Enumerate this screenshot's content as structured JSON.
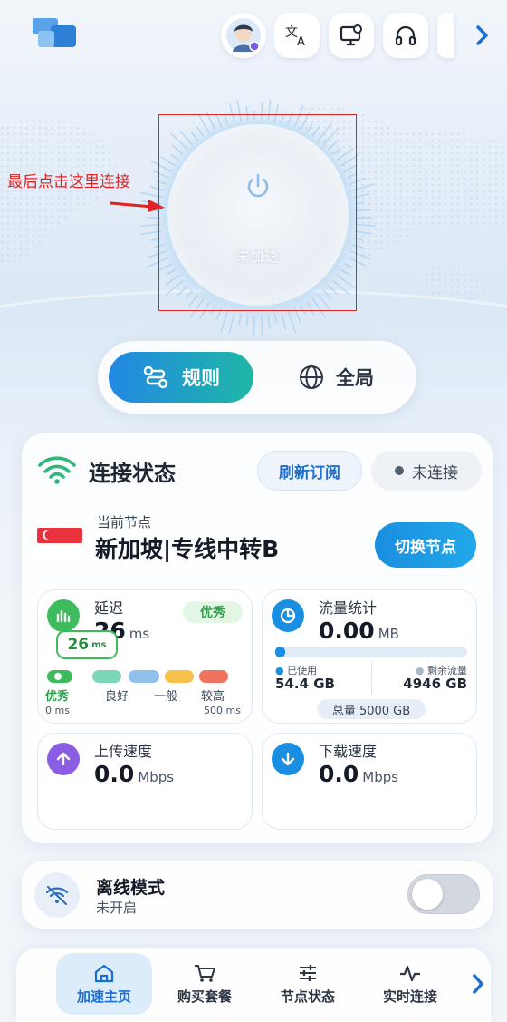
{
  "annotation": {
    "text": "最后点击这里连接"
  },
  "connect_button": {
    "status_text": "未加速"
  },
  "mode": {
    "rule_label": "规则",
    "global_label": "全局"
  },
  "status_card": {
    "title": "连接状态",
    "refresh_label": "刷新订阅",
    "connection_status": "未连接",
    "node_label": "当前节点",
    "node_name": "新加坡|专线中转B",
    "switch_node_label": "切换节点"
  },
  "latency": {
    "title": "延迟",
    "value": "26",
    "unit": "ms",
    "badge": "优秀",
    "bubble_value": "26",
    "bubble_unit": "ms",
    "levels": [
      "优秀",
      "良好",
      "一般",
      "较高"
    ],
    "range_min": "0 ms",
    "range_max": "500 ms",
    "colors": [
      "#3ebc5d",
      "#7dd6b5",
      "#8fc1ec",
      "#f6c14a",
      "#f0735e"
    ]
  },
  "traffic": {
    "title": "流量统计",
    "value": "0.00",
    "unit": "MB",
    "used_label": "已使用",
    "used_value": "54.4 GB",
    "remaining_label": "剩余流量",
    "remaining_value": "4946 GB",
    "total": "总量 5000 GB",
    "used_fraction": 0.011
  },
  "upload": {
    "title": "上传速度",
    "value": "0.0",
    "unit": "Mbps"
  },
  "download": {
    "title": "下载速度",
    "value": "0.0",
    "unit": "Mbps"
  },
  "offline": {
    "title": "离线模式",
    "subtitle": "未开启",
    "enabled": false
  },
  "nav": {
    "items": [
      "加速主页",
      "购买套餐",
      "节点状态",
      "实时连接"
    ],
    "active": "加速主页"
  },
  "icons": [
    "logo",
    "avatar",
    "translate-icon",
    "monitor-icon",
    "headset-icon",
    "chevron-right-icon",
    "power-icon",
    "route-icon",
    "globe-icon",
    "wifi-icon",
    "singapore-flag",
    "bar-chart-icon",
    "pie-chart-icon",
    "arrow-up-icon",
    "arrow-down-icon",
    "wifi-off-icon",
    "home-icon",
    "cart-icon",
    "sliders-icon",
    "activity-icon"
  ],
  "colors": {
    "accent": "#1a8ee0",
    "accent_green": "#1fb7a6",
    "annotation": "#e02424",
    "good": "#3ebc5d"
  }
}
